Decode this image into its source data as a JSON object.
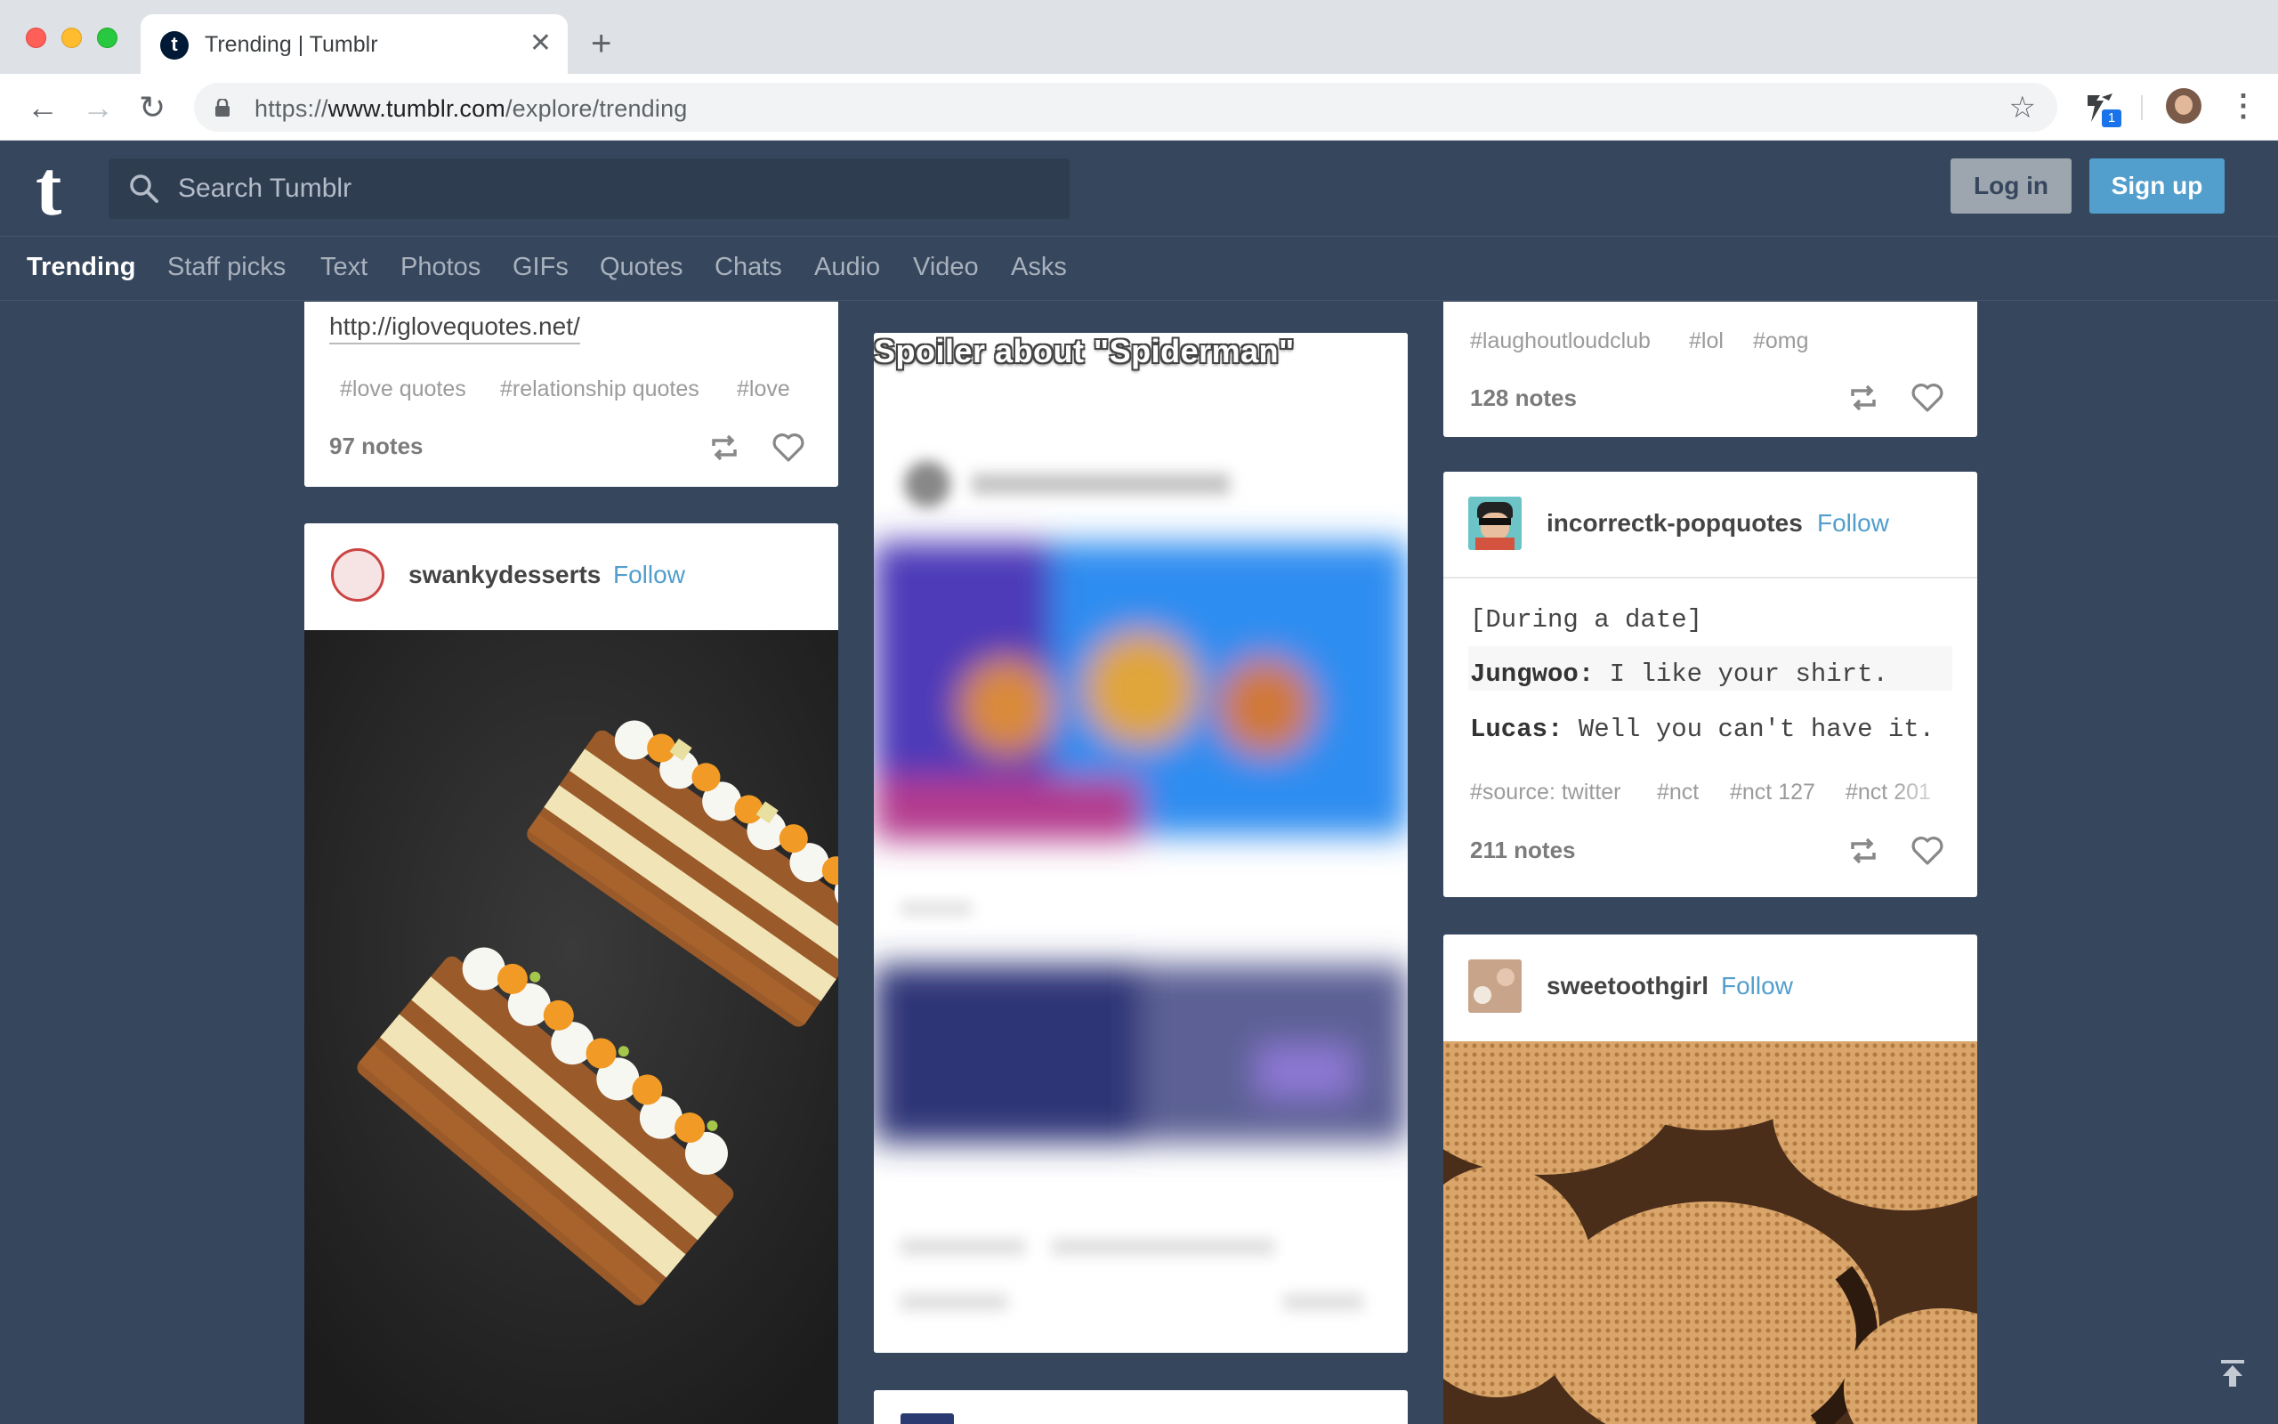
{
  "browser": {
    "tab_title": "Trending | Tumblr",
    "tab_close": "✕",
    "new_tab": "+",
    "url_scheme": "https://",
    "url_host": "www.tumblr.com",
    "url_path": "/explore/trending",
    "extension_badge": "1"
  },
  "header": {
    "logo": "t",
    "search_placeholder": "Search Tumblr",
    "login_label": "Log in",
    "signup_label": "Sign up"
  },
  "tabs": [
    "Trending",
    "Staff picks",
    "Text",
    "Photos",
    "GIFs",
    "Quotes",
    "Chats",
    "Audio",
    "Video",
    "Asks"
  ],
  "posts": {
    "quote_post": {
      "link": "http://iglovequotes.net/",
      "tags": [
        "#love quotes",
        "#relationship quotes",
        "#love"
      ],
      "notes": "97 notes"
    },
    "dessert_post": {
      "blog": "swankydesserts",
      "follow": "Follow"
    },
    "spoiler_post": {
      "overlay": "Spoiler about \"Spiderman\""
    },
    "laugh_post": {
      "tags": [
        "#laughoutloudclub",
        "#lol",
        "#omg"
      ],
      "notes": "128 notes"
    },
    "chat_post": {
      "blog": "incorrectk-popquotes",
      "follow": "Follow",
      "line0": "[During a date]",
      "speaker1": "Jungwoo:",
      "text1": " I like your shirt.",
      "speaker2": "Lucas:",
      "text2": " Well you can't have it.",
      "tags": [
        "#source: twitter",
        "#nct",
        "#nct 127",
        "#nct 201"
      ],
      "notes": "211 notes"
    },
    "cookie_post": {
      "blog": "sweetoothgirl",
      "follow": "Follow"
    }
  },
  "colors": {
    "dashboard_bg": "#36465d",
    "accent": "#529ecc"
  }
}
